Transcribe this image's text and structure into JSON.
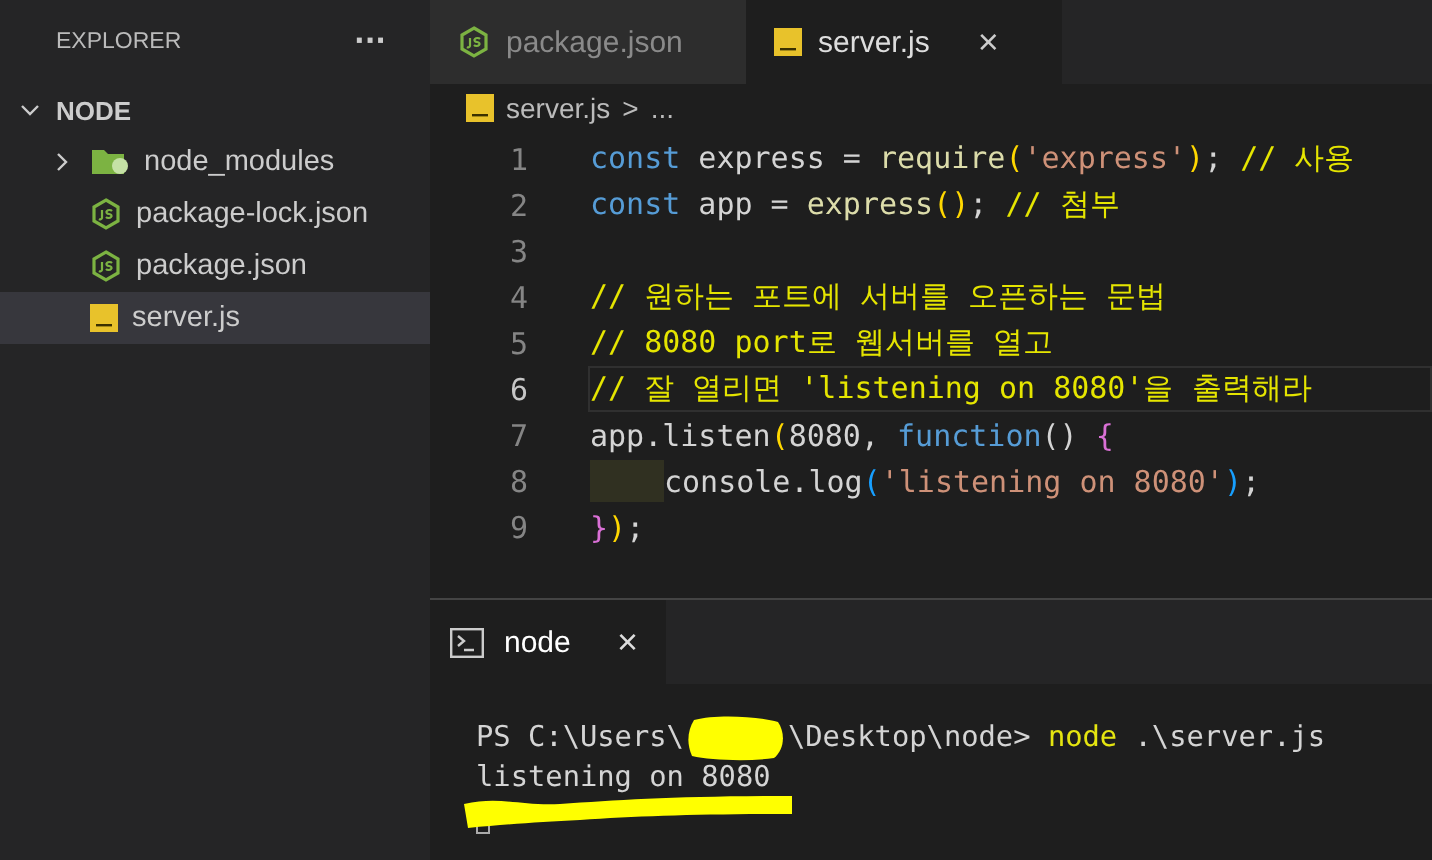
{
  "sidebar": {
    "title": "EXPLORER",
    "more": "···",
    "folder": {
      "label": "NODE",
      "expanded": true
    },
    "items": [
      {
        "label": "node_modules",
        "kind": "folder",
        "expanded": false,
        "selected": false
      },
      {
        "label": "package-lock.json",
        "kind": "json",
        "selected": false
      },
      {
        "label": "package.json",
        "kind": "json",
        "selected": false
      },
      {
        "label": "server.js",
        "kind": "js",
        "selected": true
      }
    ]
  },
  "tabs": [
    {
      "label": "package.json",
      "kind": "json",
      "selected": false
    },
    {
      "label": "server.js",
      "kind": "js",
      "selected": true,
      "close": "×"
    }
  ],
  "breadcrumb": {
    "file": "server.js",
    "kind": "js",
    "separator": ">",
    "rest": "..."
  },
  "code": [
    {
      "number": "1",
      "current": false,
      "indented": false,
      "tokens": [
        {
          "kind": "keyword",
          "text": "const"
        },
        {
          "kind": "plain",
          "text": " express = "
        },
        {
          "kind": "func",
          "text": "require"
        },
        {
          "kind": "bracket",
          "text": "("
        },
        {
          "kind": "string",
          "text": "'express'"
        },
        {
          "kind": "bracket",
          "text": ")"
        },
        {
          "kind": "plain",
          "text": "; "
        },
        {
          "kind": "comment",
          "text": "// 사용"
        }
      ]
    },
    {
      "number": "2",
      "current": false,
      "indented": false,
      "tokens": [
        {
          "kind": "keyword",
          "text": "const"
        },
        {
          "kind": "plain",
          "text": " app = "
        },
        {
          "kind": "func",
          "text": "express"
        },
        {
          "kind": "bracket",
          "text": "()"
        },
        {
          "kind": "plain",
          "text": "; "
        },
        {
          "kind": "comment",
          "text": "// 첨부"
        }
      ]
    },
    {
      "number": "3",
      "current": false,
      "indented": false
    },
    {
      "number": "4",
      "current": false,
      "indented": false,
      "tokens": [
        {
          "kind": "comment",
          "text": "// 원하는 포트에 서버를 오픈하는 문법"
        }
      ]
    },
    {
      "number": "5",
      "current": false,
      "indented": false,
      "tokens": [
        {
          "kind": "comment",
          "text": "// 8080 port로 웹서버를 열고"
        }
      ]
    },
    {
      "number": "6",
      "current": true,
      "indented": false,
      "tokens": [
        {
          "kind": "comment",
          "text": "// 잘 열리면 'listening on 8080'을 출력해라"
        }
      ]
    },
    {
      "number": "7",
      "current": false,
      "indented": false,
      "tokens": [
        {
          "kind": "plain",
          "text": "app.listen"
        },
        {
          "kind": "bracket",
          "text": "("
        },
        {
          "kind": "plain",
          "text": "8080, "
        },
        {
          "kind": "keyword",
          "text": "function"
        },
        {
          "kind": "plain",
          "text": "() "
        },
        {
          "kind": "bracket2",
          "text": "{"
        }
      ]
    },
    {
      "number": "8",
      "current": false,
      "indented": true,
      "tokens": [
        {
          "kind": "plain",
          "text": "console.log"
        },
        {
          "kind": "bracket3",
          "text": "("
        },
        {
          "kind": "string",
          "text": "'listening on 8080'"
        },
        {
          "kind": "bracket3",
          "text": ")"
        },
        {
          "kind": "plain",
          "text": ";"
        }
      ]
    },
    {
      "number": "9",
      "current": false,
      "indented": false,
      "tokens": [
        {
          "kind": "bracket2",
          "text": "}"
        },
        {
          "kind": "bracket",
          "text": ")"
        },
        {
          "kind": "plain",
          "text": ";"
        }
      ]
    }
  ],
  "terminal": {
    "tab": {
      "label": "node",
      "close": "×",
      "selected": true
    },
    "lines": [
      {
        "underlined": false,
        "cursor": false,
        "tokens": [
          {
            "kind": "plain",
            "text": "PS C:\\Users\\"
          },
          {
            "kind": "redacted"
          },
          {
            "kind": "plain",
            "text": "\\Desktop\\node> "
          },
          {
            "kind": "command",
            "text": "node"
          },
          {
            "kind": "plain",
            "text": " .\\server.js"
          }
        ]
      },
      {
        "underlined": false,
        "cursor": false,
        "tokens": [
          {
            "kind": "plain",
            "text": "listening on 8080"
          }
        ]
      },
      {
        "underlined": true,
        "cursor": true
      }
    ]
  }
}
